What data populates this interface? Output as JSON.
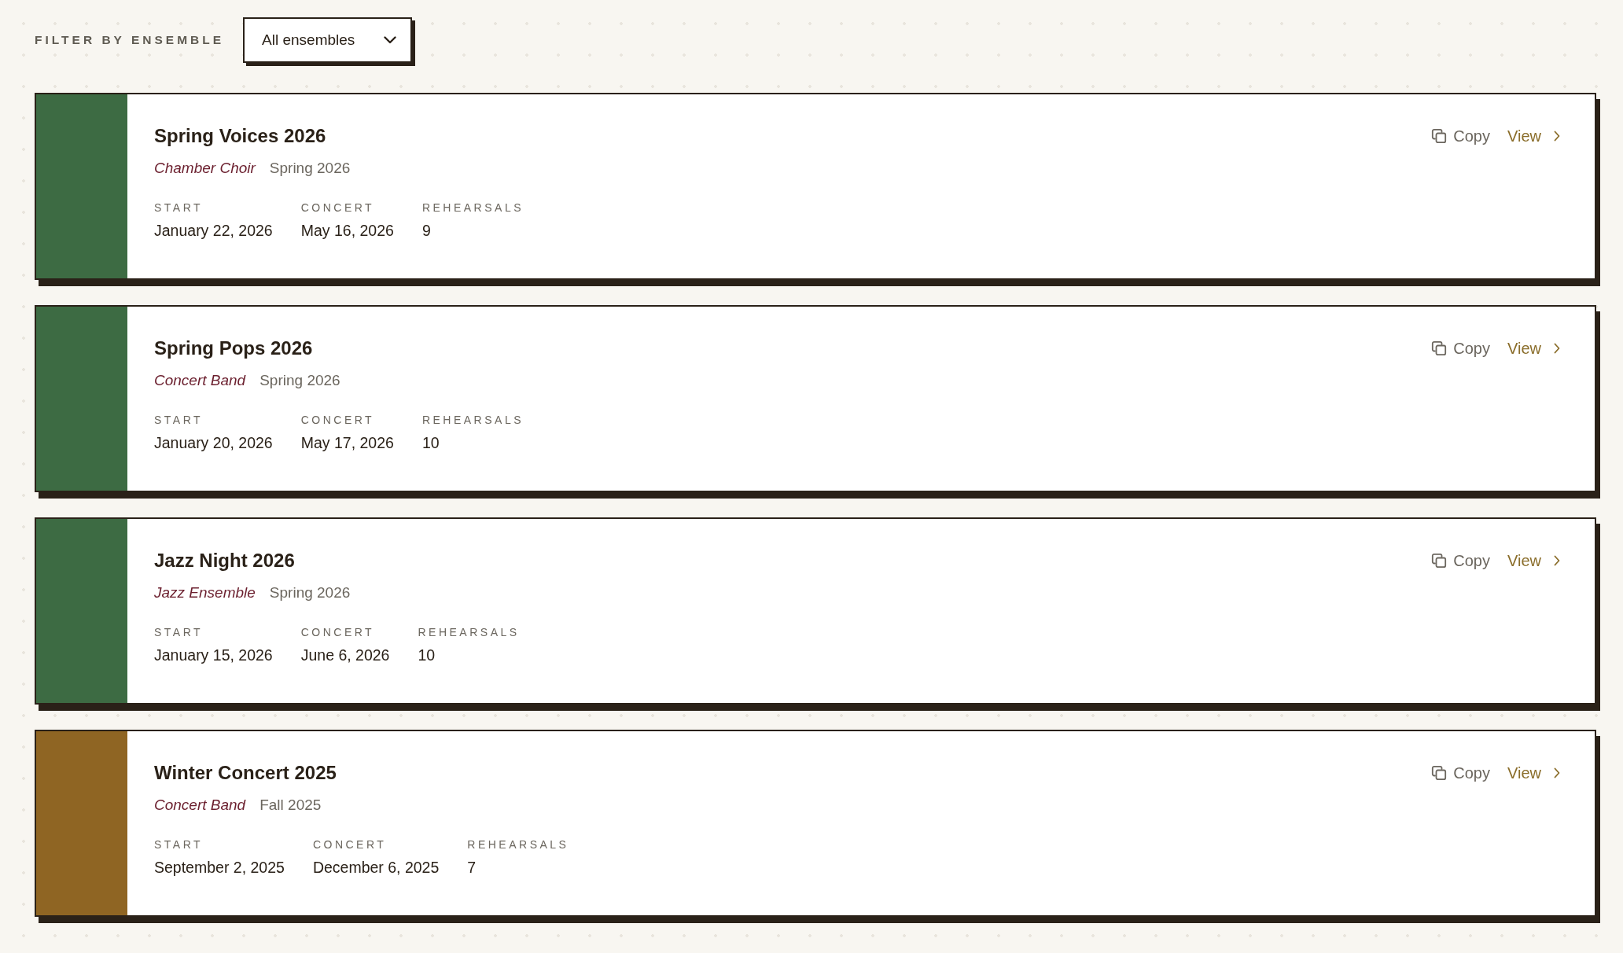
{
  "filter": {
    "label": "FILTER BY ENSEMBLE",
    "select": {
      "value": "All ensembles"
    }
  },
  "projects": [
    {
      "title": "Spring Voices 2026",
      "ensemble": "Chamber Choir",
      "season": "Spring 2026",
      "color": "#3d6b43",
      "fields": [
        {
          "label": "START",
          "value": "January 22, 2026"
        },
        {
          "label": "CONCERT",
          "value": "May 16, 2026"
        },
        {
          "label": "REHEARSALS",
          "value": "9"
        }
      ],
      "copy_label": "Copy",
      "view_label": "View"
    },
    {
      "title": "Spring Pops 2026",
      "ensemble": "Concert Band",
      "season": "Spring 2026",
      "color": "#3d6b43",
      "fields": [
        {
          "label": "START",
          "value": "January 20, 2026"
        },
        {
          "label": "CONCERT",
          "value": "May 17, 2026"
        },
        {
          "label": "REHEARSALS",
          "value": "10"
        }
      ],
      "copy_label": "Copy",
      "view_label": "View"
    },
    {
      "title": "Jazz Night 2026",
      "ensemble": "Jazz Ensemble",
      "season": "Spring 2026",
      "color": "#3d6b43",
      "fields": [
        {
          "label": "START",
          "value": "January 15, 2026"
        },
        {
          "label": "CONCERT",
          "value": "June 6, 2026"
        },
        {
          "label": "REHEARSALS",
          "value": "10"
        }
      ],
      "copy_label": "Copy",
      "view_label": "View"
    },
    {
      "title": "Winter Concert 2025",
      "ensemble": "Concert Band",
      "season": "Fall 2025",
      "color": "#8f6523",
      "fields": [
        {
          "label": "START",
          "value": "September 2, 2025"
        },
        {
          "label": "CONCERT",
          "value": "December 6, 2025"
        },
        {
          "label": "REHEARSALS",
          "value": "7"
        }
      ],
      "copy_label": "Copy",
      "view_label": "View"
    }
  ]
}
